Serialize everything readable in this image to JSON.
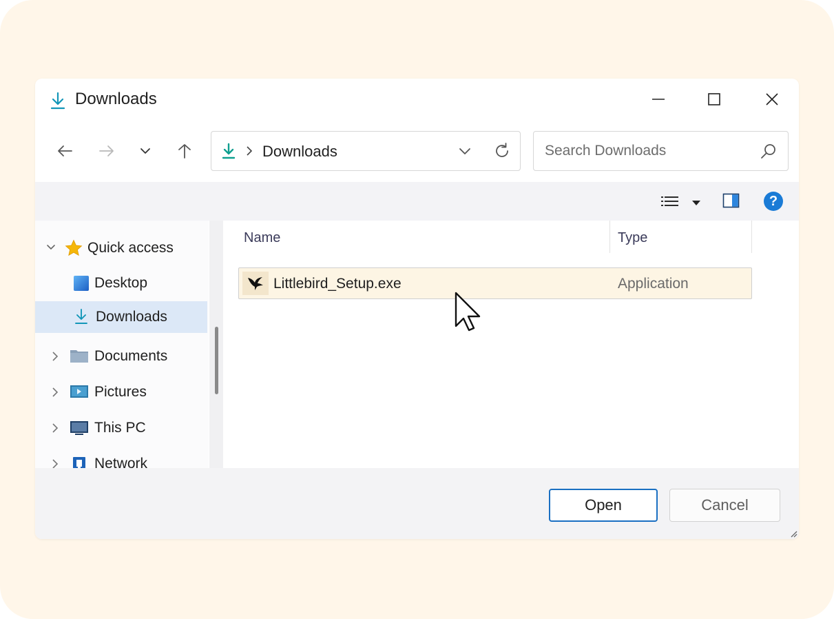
{
  "window": {
    "title": "Downloads",
    "icons": {
      "title": "download-icon",
      "minimize": "minimize-icon",
      "maximize": "maximize-icon",
      "close": "close-icon"
    }
  },
  "navigation": {
    "back_icon": "arrow-left-icon",
    "forward_icon": "arrow-right-icon",
    "recent_icon": "chevron-down-icon",
    "up_icon": "arrow-up-icon"
  },
  "address_bar": {
    "separator": ">",
    "location": "Downloads",
    "refresh_icon": "refresh-icon"
  },
  "search": {
    "placeholder": "Search Downloads",
    "value": "",
    "icon": "search-icon"
  },
  "toolbar": {
    "view_icon": "list-view-icon",
    "preview_icon": "preview-pane-icon",
    "help_icon": "help-icon",
    "help_glyph": "?"
  },
  "sidebar": {
    "items": [
      {
        "label": "Quick access",
        "icon": "star-icon",
        "expanded": true
      },
      {
        "label": "Desktop",
        "icon": "desktop-icon"
      },
      {
        "label": "Downloads",
        "icon": "download-icon",
        "selected": true
      },
      {
        "label": "Documents",
        "icon": "folder-icon"
      },
      {
        "label": "Pictures",
        "icon": "pictures-icon"
      },
      {
        "label": "This PC",
        "icon": "pc-icon"
      },
      {
        "label": "Network",
        "icon": "network-icon"
      }
    ]
  },
  "file_list": {
    "columns": [
      "Name",
      "Type"
    ],
    "rows": [
      {
        "name": "Littlebird_Setup.exe",
        "type": "Application",
        "icon": "bird-icon",
        "selected": true
      }
    ]
  },
  "footer": {
    "open_label": "Open",
    "cancel_label": "Cancel"
  },
  "colors": {
    "accent": "#1a6fc2",
    "selection": "#dce8f7",
    "file_highlight": "#fdf5e4",
    "backdrop": "#fff6e9"
  }
}
